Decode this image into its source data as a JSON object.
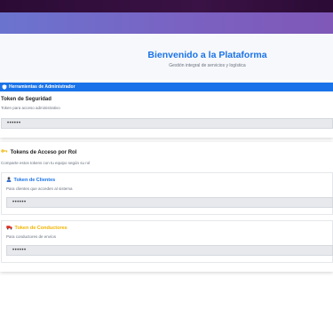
{
  "hero": {
    "title": "Bienvenido a la Plataforma",
    "subtitle": "Gestión integral de servicios y logística"
  },
  "admin": {
    "bar_label": "Herramientas de Administrador",
    "security_token": {
      "label": "Token de Seguridad",
      "description": "Token para acceso administrativo",
      "value": "••••••"
    }
  },
  "roles": {
    "title": "Tokens de Acceso por Rol",
    "description": "Comparte estos tokens con tu equipo según su rol",
    "clients": {
      "title": "Token de Clientes",
      "description": "Para clientes que acceden al sistema",
      "value": "••••••"
    },
    "drivers": {
      "title": "Token de Conductores",
      "description": "Para conductores de envíos",
      "value": "••••••"
    }
  },
  "colors": {
    "accent": "#1a73e8",
    "drivers_accent": "#f0b400",
    "header_gradient_start": "#6a74cf",
    "header_gradient_end": "#7f58b8"
  },
  "icons": {
    "admin": "shield-icon",
    "roles": "key-icon",
    "clients": "user-icon",
    "drivers": "truck-icon"
  }
}
